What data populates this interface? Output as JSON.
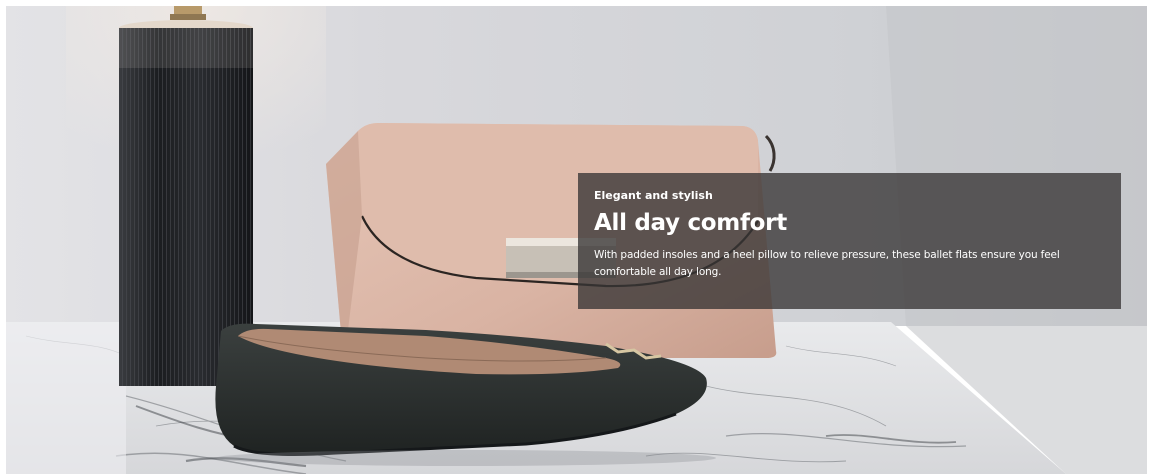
{
  "banner": {
    "eyebrow": "Elegant and stylish",
    "headline": "All day comfort",
    "body": "With padded insoles and a heel pillow to relieve pressure, these ballet flats ensure you feel comfortable all day long."
  },
  "image": {
    "subjects": [
      "table-lamp",
      "handbag",
      "ballet-flat",
      "marble-table"
    ],
    "colors": {
      "wall": "#d4d6da",
      "handbag": "#dcb8a8",
      "shoe": "#2e3231",
      "lamp": "#1e2022",
      "marble": "#e7e8ea"
    }
  }
}
